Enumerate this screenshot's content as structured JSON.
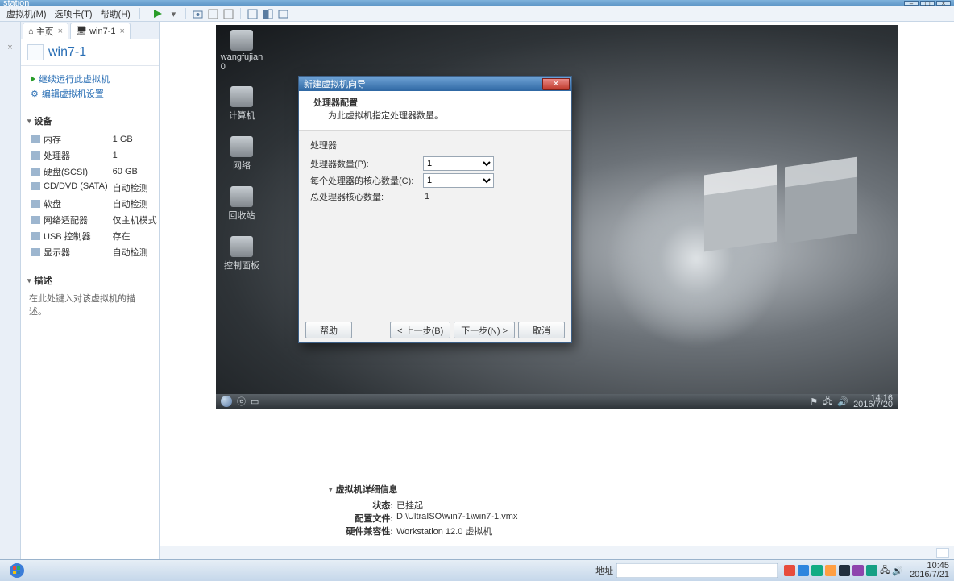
{
  "app": {
    "title": "station"
  },
  "menu": {
    "vm": "虚拟机(M)",
    "tabs": "选项卡(T)",
    "help": "帮助(H)"
  },
  "home_tab": {
    "label": "主页"
  },
  "vm_tab": {
    "label": "win7-1"
  },
  "vm": {
    "name": "win7-1",
    "action_continue": "继续运行此虚拟机",
    "action_edit": "编辑虚拟机设置"
  },
  "sidebar": {
    "devices_hdr": "设备",
    "devices": [
      {
        "label": "内存",
        "value": "1 GB"
      },
      {
        "label": "处理器",
        "value": "1"
      },
      {
        "label": "硬盘(SCSI)",
        "value": "60 GB"
      },
      {
        "label": "CD/DVD (SATA)",
        "value": "自动检测"
      },
      {
        "label": "软盘",
        "value": "自动检测"
      },
      {
        "label": "网络适配器",
        "value": "仅主机模式"
      },
      {
        "label": "USB 控制器",
        "value": "存在"
      },
      {
        "label": "显示器",
        "value": "自动检测"
      }
    ],
    "desc_hdr": "描述",
    "desc_placeholder": "在此处键入对该虚拟机的描述。"
  },
  "guest": {
    "desktop_icons": [
      "wangfujian 0",
      "计算机",
      "网络",
      "回收站",
      "控制面板"
    ],
    "clock_time": "14:16",
    "clock_date": "2016/7/20"
  },
  "wizard": {
    "title": "新建虚拟机向导",
    "header": "处理器配置",
    "sub": "为此虚拟机指定处理器数量。",
    "group": "处理器",
    "row_count": "处理器数量(P):",
    "row_cores": "每个处理器的核心数量(C):",
    "row_total": "总处理器核心数量:",
    "val_count": "1",
    "val_cores": "1",
    "val_total": "1",
    "btn_help": "帮助",
    "btn_back": "< 上一步(B)",
    "btn_next": "下一步(N) >",
    "btn_cancel": "取消"
  },
  "details": {
    "hdr": "虚拟机详细信息",
    "state_k": "状态:",
    "state_v": "已挂起",
    "cfg_k": "配置文件:",
    "cfg_v": "D:\\UltraISO\\win7-1\\win7-1.vmx",
    "compat_k": "硬件兼容性:",
    "compat_v": "Workstation 12.0 虚拟机"
  },
  "host": {
    "addr_label": "地址",
    "clock_time": "10:45",
    "clock_date": "2016/7/21"
  }
}
